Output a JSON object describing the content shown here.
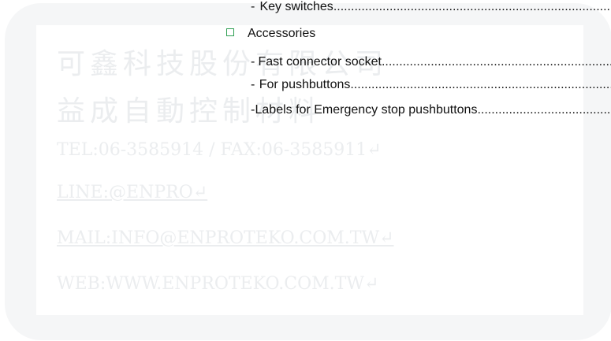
{
  "watermark": {
    "company_name": "可鑫科技股份有限公司",
    "company_name2": "益成自動控制材料",
    "tel_fax": "TEL:06-3585914 / FAX:06-3585911↵",
    "line": "LINE:@ENPRO↵",
    "mail": "MAIL:INFO@ENPROTEKO.COM.TW↵",
    "web": "WEB:WWW.ENPROTEKO.COM.TW↵"
  },
  "toc": {
    "dash": "-",
    "leader": "..................................................................................................................................................................................................",
    "items": [
      {
        "type": "subitem",
        "label": "Key switches"
      },
      {
        "type": "category",
        "label": "Accessories"
      },
      {
        "type": "subitem",
        "label": "Fast connector socket"
      },
      {
        "type": "subitem",
        "label": "For pushbuttons"
      },
      {
        "type": "subitem",
        "label": "Labels for Emergency stop pushbuttons"
      }
    ]
  },
  "colors": {
    "bullet_border": "#2e9e52",
    "watermark_text": "#ebedef",
    "watermark_frame": "#f5f6f7"
  }
}
